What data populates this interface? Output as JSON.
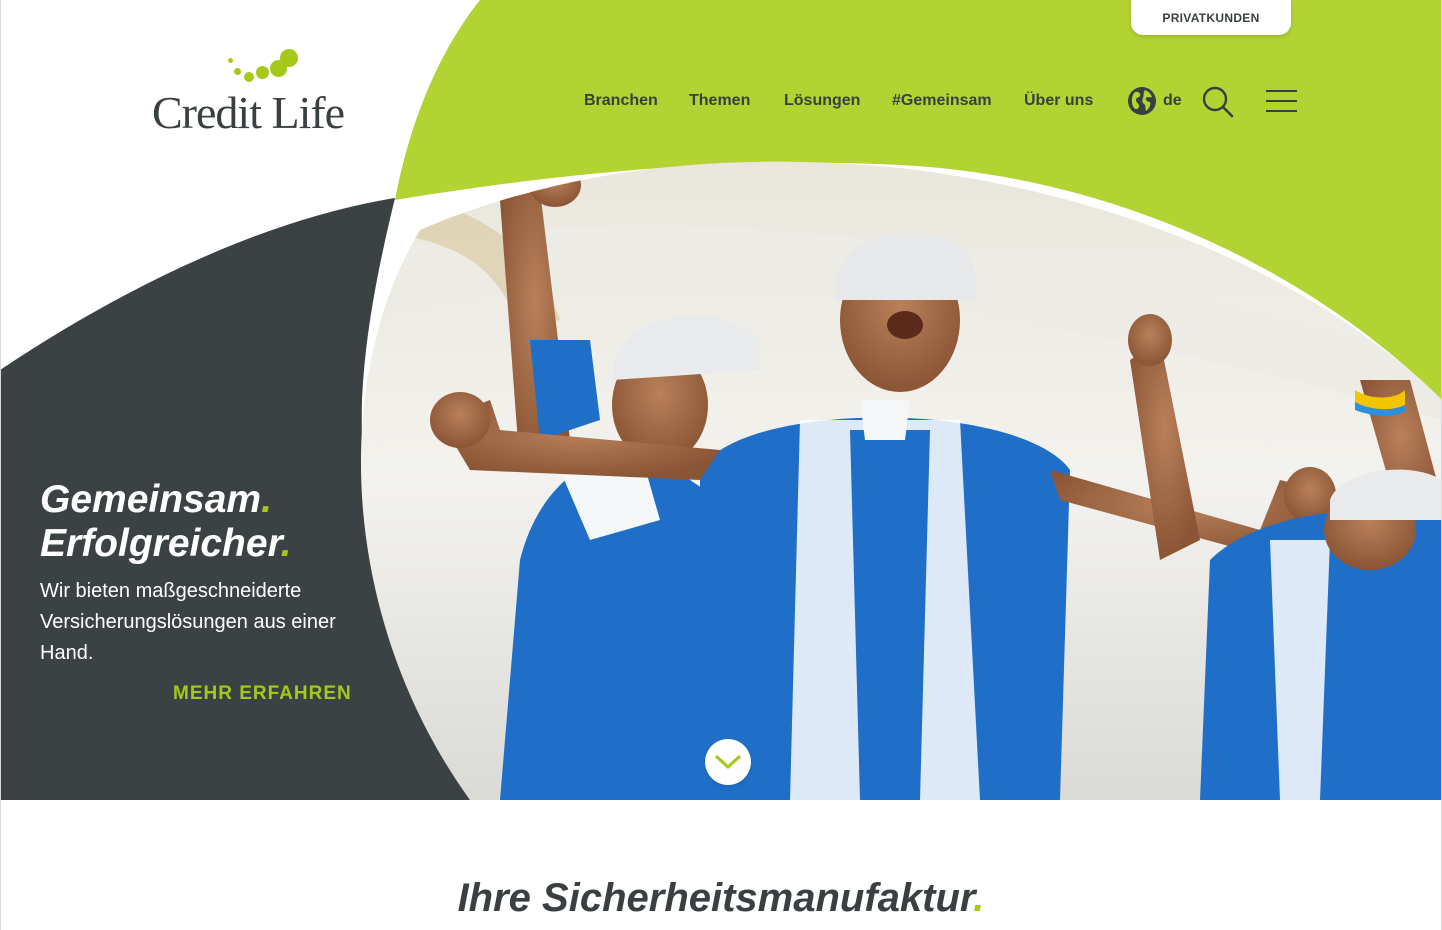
{
  "header": {
    "logo_text": "Credit Life",
    "privat_tab_label": "PRIVATKUNDEN",
    "nav": [
      {
        "label": "Branchen"
      },
      {
        "label": "Themen"
      },
      {
        "label": "Lösungen"
      },
      {
        "label": "#Gemeinsam"
      },
      {
        "label": "Über uns"
      }
    ],
    "language": "de",
    "icons": {
      "globe": "globe-icon",
      "search": "search-icon",
      "menu": "hamburger-menu-icon"
    }
  },
  "hero": {
    "title_line1": "Gemeinsam",
    "title_line2": "Erfolgreicher",
    "title_dot": ".",
    "subtitle": "Wir bieten maßgeschneiderte Versicherungslösungen aus einer Hand.",
    "cta_label": "MEHR ERFAHREN",
    "scroll_icon": "chevron-down-icon",
    "image_alt": "Cycling team in blue jerseys cheering"
  },
  "section": {
    "title": "Ihre Sicherheitsmanufaktur",
    "title_dot": "."
  },
  "colors": {
    "brand_green": "#a6c919",
    "dark_gray": "#3a3f41",
    "jersey_blue": "#1f6fc8"
  }
}
